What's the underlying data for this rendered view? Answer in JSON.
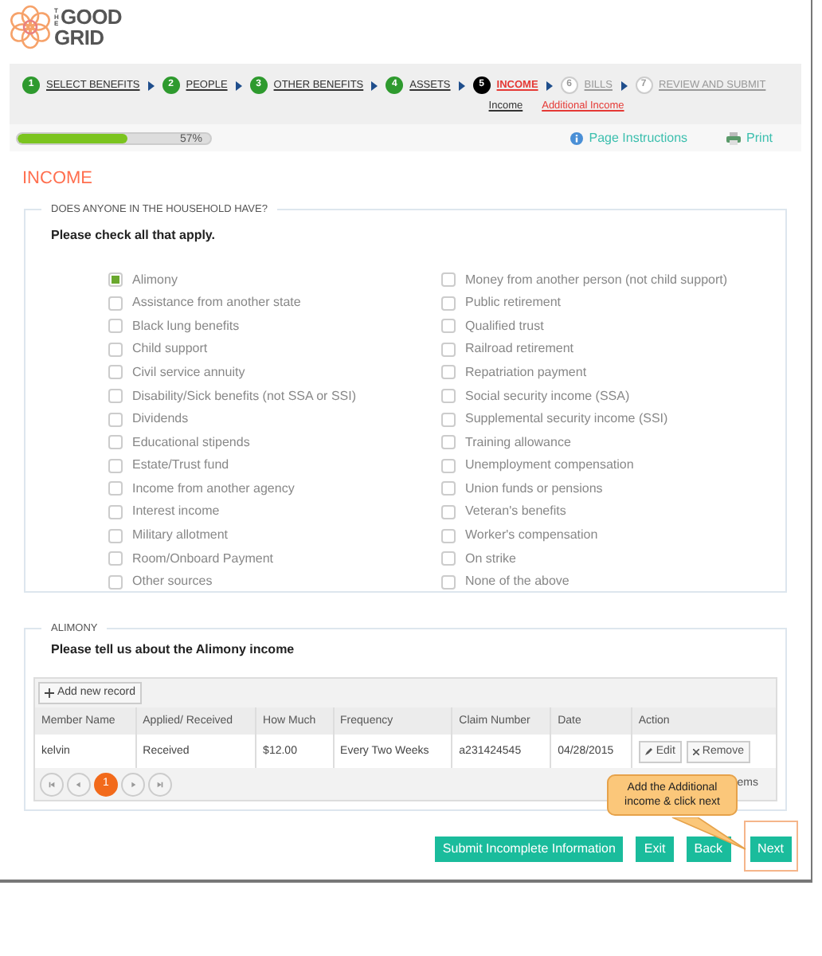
{
  "logo": {
    "line1": "GOOD",
    "line2": "GRID",
    "side": "THE"
  },
  "steps": [
    {
      "number": "1",
      "label": "SELECT BENEFITS",
      "completed": true,
      "selected": false
    },
    {
      "number": "2",
      "label": "PEOPLE",
      "completed": true,
      "selected": false
    },
    {
      "number": "3",
      "label": "OTHER BENEFITS",
      "completed": true,
      "selected": false
    },
    {
      "number": "4",
      "label": "ASSETS",
      "completed": true,
      "selected": false
    },
    {
      "number": "5",
      "label": "INCOME",
      "completed": false,
      "selected": true
    },
    {
      "number": "6",
      "label": "BILLS",
      "completed": false,
      "selected": false
    },
    {
      "number": "7",
      "label": "REVIEW AND SUBMIT",
      "completed": false,
      "selected": false
    }
  ],
  "substeps": [
    {
      "label": "Income",
      "selected": false
    },
    {
      "label": "Additional Income",
      "selected": true
    }
  ],
  "progress": {
    "level": 0.57,
    "reading": "57%"
  },
  "links": [
    {
      "kind": "info",
      "label": "Page Instructions"
    },
    {
      "kind": "print",
      "label": "Print"
    }
  ],
  "heading": "INCOME",
  "household": {
    "legend": "DOES ANYONE IN THE HOUSEHOLD HAVE?",
    "prompt": "Please check all that apply.",
    "left": [
      {
        "label": "Alimony",
        "checked": true
      },
      {
        "label": "Assistance from another state",
        "checked": false
      },
      {
        "label": "Black lung benefits",
        "checked": false
      },
      {
        "label": "Child support",
        "checked": false
      },
      {
        "label": "Civil service annuity",
        "checked": false
      },
      {
        "label": "Disability/Sick benefits (not SSA or SSI)",
        "checked": false
      },
      {
        "label": "Dividends",
        "checked": false
      },
      {
        "label": "Educational stipends",
        "checked": false
      },
      {
        "label": "Estate/Trust fund",
        "checked": false
      },
      {
        "label": "Income from another agency",
        "checked": false
      },
      {
        "label": "Interest income",
        "checked": false
      },
      {
        "label": "Military allotment",
        "checked": false
      },
      {
        "label": "Room/Onboard Payment",
        "checked": false
      },
      {
        "label": "Other sources",
        "checked": false
      }
    ],
    "right": [
      {
        "label": "Money from another person (not child support)",
        "checked": false
      },
      {
        "label": "Public retirement",
        "checked": false
      },
      {
        "label": "Qualified trust",
        "checked": false
      },
      {
        "label": "Railroad retirement",
        "checked": false
      },
      {
        "label": "Repatriation payment",
        "checked": false
      },
      {
        "label": "Social security income (SSA)",
        "checked": false
      },
      {
        "label": "Supplemental security income (SSI)",
        "checked": false
      },
      {
        "label": "Training allowance",
        "checked": false
      },
      {
        "label": "Unemployment compensation",
        "checked": false
      },
      {
        "label": "Union funds or pensions",
        "checked": false
      },
      {
        "label": "Veteran's benefits",
        "checked": false
      },
      {
        "label": "Worker's compensation",
        "checked": false
      },
      {
        "label": "On strike",
        "checked": false
      },
      {
        "label": "None of the above",
        "checked": false
      }
    ]
  },
  "alimony": {
    "legend": "ALIMONY",
    "prompt": "Please tell us about the Alimony income",
    "add_button": "Add new record",
    "columns": [
      "Member Name",
      "Applied/ Received",
      "How Much",
      "Frequency",
      "Claim Number",
      "Date",
      "Action"
    ],
    "rows": [
      {
        "cells": [
          "kelvin",
          "Received",
          "$12.00",
          "Every Two Weeks",
          "a231424545",
          "04/28/2015"
        ],
        "actions": [
          "Edit",
          "Remove"
        ]
      }
    ],
    "pages": [
      {
        "label": "1",
        "selected": true
      }
    ],
    "pager_info": "ems"
  },
  "callout": "Add the Additional income & click next",
  "buttons": [
    {
      "label": "Submit Incomplete Information",
      "highlighted": false
    },
    {
      "label": "Exit",
      "highlighted": false
    },
    {
      "label": "Back",
      "highlighted": false
    },
    {
      "label": "Next",
      "highlighted": true
    }
  ]
}
